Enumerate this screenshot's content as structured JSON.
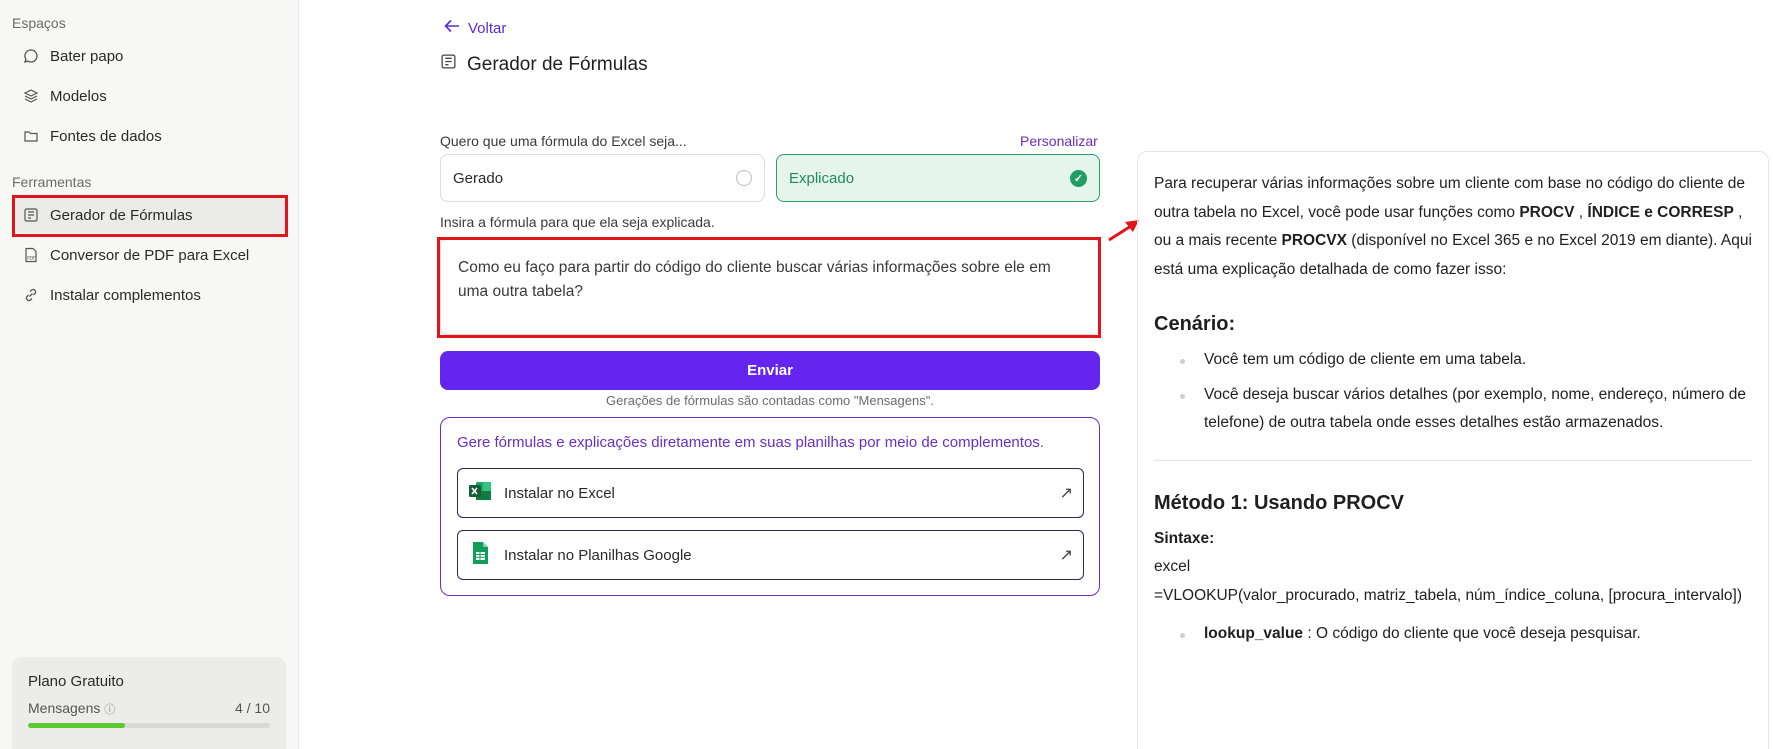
{
  "sidebar": {
    "section_spaces": "Espaços",
    "spaces": [
      {
        "label": "Bater papo",
        "icon": "chat-icon"
      },
      {
        "label": "Modelos",
        "icon": "layers-icon"
      },
      {
        "label": "Fontes de dados",
        "icon": "folder-icon"
      }
    ],
    "section_tools": "Ferramentas",
    "tools": [
      {
        "label": "Gerador de Fórmulas",
        "icon": "formula-icon",
        "active": true
      },
      {
        "label": "Conversor de PDF para Excel",
        "icon": "pdf-icon"
      },
      {
        "label": "Instalar complementos",
        "icon": "link-icon"
      }
    ],
    "plan": {
      "title": "Plano Gratuito",
      "messages_label": "Mensagens",
      "messages_count": "4 / 10",
      "progress_fraction": 0.4,
      "progress_color": "#5ac92f"
    }
  },
  "main": {
    "back_label": "Voltar",
    "title": "Gerador de Fórmulas",
    "question_label": "Quero que uma fórmula do Excel seja...",
    "personalize_label": "Personalizar",
    "options": {
      "generated": "Gerado",
      "explained": "Explicado",
      "selected": "explained"
    },
    "insert_label": "Insira a fórmula para que ela seja explicada.",
    "input_value": "Como eu faço para partir do código do cliente buscar várias informações sobre ele em uma outra tabela?",
    "send_label": "Enviar",
    "send_note": "Gerações de fórmulas são contadas como \"Mensagens\".",
    "addons": {
      "title": "Gere fórmulas e explicações diretamente em suas planilhas por meio de complementos.",
      "excel": "Instalar no Excel",
      "sheets": "Instalar no Planilhas Google"
    }
  },
  "answer": {
    "intro_1": "Para recuperar várias informações sobre um cliente com base no código do cliente de outra tabela no Excel, você pode usar funções como ",
    "procv": "PROCV",
    "comma": " , ",
    "indice_corresp": "ÍNDICE e CORRESP",
    "intro_2": " , ou a mais recente ",
    "procvx": "PROCVX",
    "intro_3": " (disponível no Excel 365 e no Excel 2019 em diante). Aqui está uma explicação detalhada de como fazer isso:",
    "scenario_title": "Cenário:",
    "scenario_items": [
      "Você tem um código de cliente em uma tabela.",
      "Você deseja buscar vários detalhes (por exemplo, nome, endereço, número de telefone) de outra tabela onde esses detalhes estão armazenados."
    ],
    "method1_title": "Método 1: Usando PROCV",
    "syntax_label": "Sintaxe:",
    "code_lang": "excel",
    "code": "=VLOOKUP(valor_procurado, matriz_tabela, núm_índice_coluna, [procura_intervalo])",
    "param_name": "lookup_value",
    "param_desc": " : O código do cliente que você deseja pesquisar."
  },
  "colors": {
    "accent": "#6425ef",
    "highlight": "#e3151a",
    "success": "#1f9f63"
  }
}
